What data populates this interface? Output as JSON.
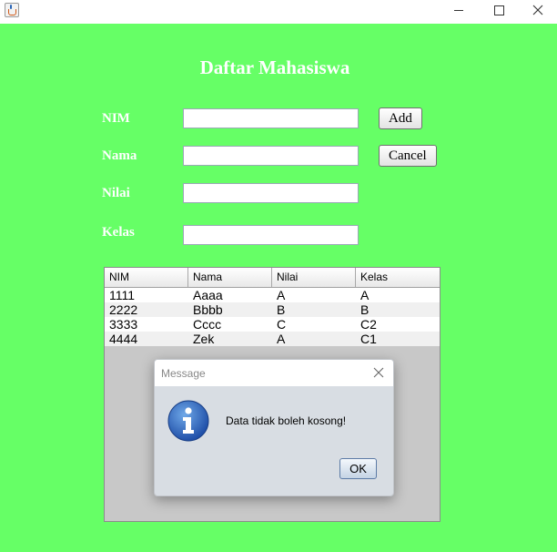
{
  "window": {
    "app_icon": "java-cup-icon",
    "controls": [
      "minimize-icon",
      "maximize-icon",
      "close-icon"
    ]
  },
  "form": {
    "title": "Daftar Mahasiswa",
    "fields": {
      "nim": {
        "label": "NIM",
        "value": ""
      },
      "nama": {
        "label": "Nama",
        "value": ""
      },
      "nilai": {
        "label": "Nilai",
        "value": ""
      },
      "kelas": {
        "label": "Kelas",
        "value": ""
      }
    },
    "add_label": "Add",
    "cancel_label": "Cancel",
    "background_color": "#66ff66"
  },
  "table": {
    "columns": [
      "NIM",
      "Nama",
      "Nilai",
      "Kelas"
    ],
    "rows": [
      [
        "1111",
        "Aaaa",
        "A",
        "A"
      ],
      [
        "2222",
        "Bbbb",
        "B",
        "B"
      ],
      [
        "3333",
        "Cccc",
        "C",
        "C2"
      ],
      [
        "4444",
        "Zek",
        "A",
        "C1"
      ]
    ]
  },
  "dialog": {
    "title": "Message",
    "icon": "info-icon",
    "message": "Data tidak boleh kosong!",
    "ok_label": "OK"
  }
}
